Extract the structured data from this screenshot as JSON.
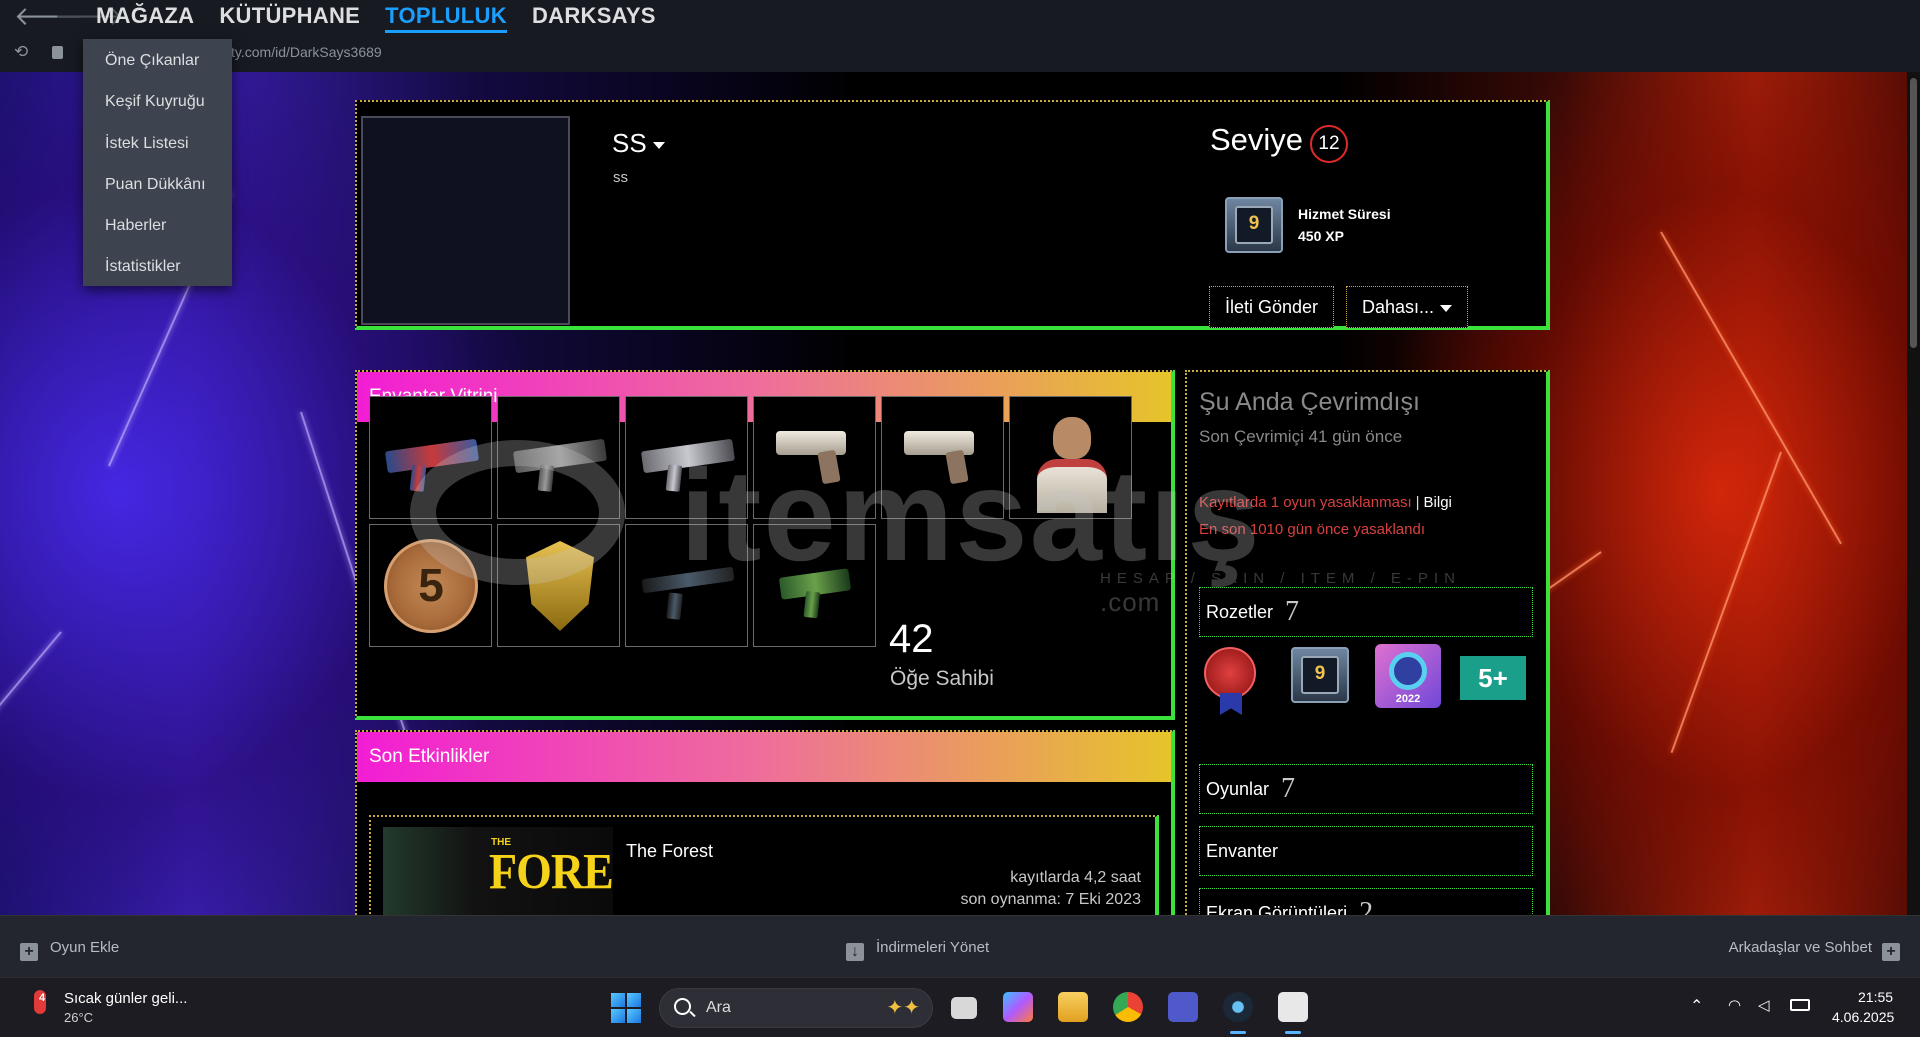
{
  "nav": {
    "back_icon": "arrow-left-icon",
    "forward_icon": "arrow-right-icon",
    "tabs": [
      "MAĞAZA",
      "KÜTÜPHANE",
      "TOPLULUK",
      "DARKSAYS"
    ],
    "active_tab": "TOPLULUK",
    "url_visible": "ty.com/id/DarkSays3689",
    "dropdown": [
      "Öne Çıkanlar",
      "Keşif Kuyruğu",
      "İstek Listesi",
      "Puan Dükkânı",
      "Haberler",
      "İstatistikler"
    ]
  },
  "profile": {
    "persona_name": "SS",
    "real_name": "ss",
    "level_label": "Seviye",
    "level": "12",
    "service_badge_value": "9",
    "service_badge_name": "Hizmet Süresi",
    "service_badge_xp": "450 XP",
    "send_message": "İleti Gönder",
    "more": "Dahası..."
  },
  "inventory": {
    "title": "Envanter Vitrini",
    "item_count": "42",
    "item_count_label": "Öğe Sahibi",
    "coin_value": "5"
  },
  "activity": {
    "title": "Son Etkinlikler",
    "cover_the": "THE",
    "cover_title": "FOREST",
    "game_name": "The Forest",
    "hours": "kayıtlarda 4,2 saat",
    "last_played": "son oynanma: 7 Eki 2023"
  },
  "status": {
    "title": "Şu Anda Çevrimdışı",
    "last_online": "Son Çevrimiçi 41 gün önce",
    "ban_text": "Kayıtlarda 1 oyun yasaklanması",
    "ban_sep": "|",
    "ban_info": "Bilgi",
    "ban_date": "En son 1010 gün önce yasaklandı",
    "badges_label": "Rozetler",
    "badges_count": "7",
    "badge_service_value": "9",
    "badge_year": "2022",
    "badge_5plus": "5+",
    "games_label": "Oyunlar",
    "games_count": "7",
    "inventory_label": "Envanter",
    "screenshots_label": "Ekran Görüntüleri",
    "screenshots_count": "2"
  },
  "watermark": {
    "text": "itemsatış",
    "sub": "HESAP / SKIN / ITEM / E-PIN",
    "com": ".com"
  },
  "bottombar": {
    "add_game": "Oyun Ekle",
    "downloads": "İndirmeleri Yönet",
    "friends": "Arkadaşlar ve Sohbet"
  },
  "taskbar": {
    "weather_badge": "4",
    "weather_title": "Sıcak günler geli...",
    "weather_temp": "26°C",
    "search_label": "Ara",
    "time": "21:55",
    "date": "4.06.2025"
  },
  "colors": {
    "accent_blue": "#1a9fff",
    "panel_border_green": "#3be23b",
    "panel_dotted_gold": "#c8a838",
    "title_gradient_start": "#f21dd5",
    "title_gradient_end": "#e6c42a",
    "ban_red": "#d94040"
  }
}
